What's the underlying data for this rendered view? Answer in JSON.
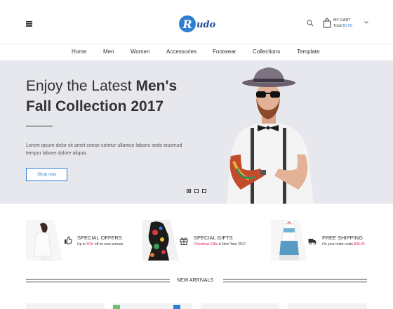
{
  "header": {
    "logo_letter": "R",
    "logo_text": "udo",
    "cart_label": "MY CART",
    "cart_total_label": "Total",
    "cart_total_value": "$0.00"
  },
  "nav": {
    "items": [
      "Home",
      "Men",
      "Women",
      "Accessories",
      "Footwear",
      "Collections",
      "Template"
    ]
  },
  "hero": {
    "heading_prefix": "Enjoy the Latest",
    "heading_bold": "Men's",
    "heading_line2": "Fall Collection 2017",
    "description": "Lorem ipsum dolor sit amet conse cotetur ullamco laboris sedo eiusmod tempor labore dolore aliqua.",
    "button_label": "Shop now",
    "slide_count": 3,
    "active_slide": 1
  },
  "features": [
    {
      "title": "SPECIAL OFFERS",
      "sub_before": "Up to ",
      "sub_highlight": "50%",
      "sub_after": " off on new arrivals",
      "icon": "thumbs-up-icon"
    },
    {
      "title": "SPECIAL GIFTS",
      "sub_before": "",
      "sub_highlight": "Christmas Gifts",
      "sub_after": " & New Year 2017",
      "icon": "gift-icon"
    },
    {
      "title": "FREE SHIPPING",
      "sub_before": "On your order costs ",
      "sub_highlight": "$99.00",
      "sub_after": "",
      "icon": "truck-icon"
    }
  ],
  "new_arrivals": {
    "title": "NEW ARRIVALS"
  },
  "colors": {
    "accent": "#2f7fd1",
    "highlight": "#e0245e",
    "hero_bg": "#e7e8ed"
  }
}
